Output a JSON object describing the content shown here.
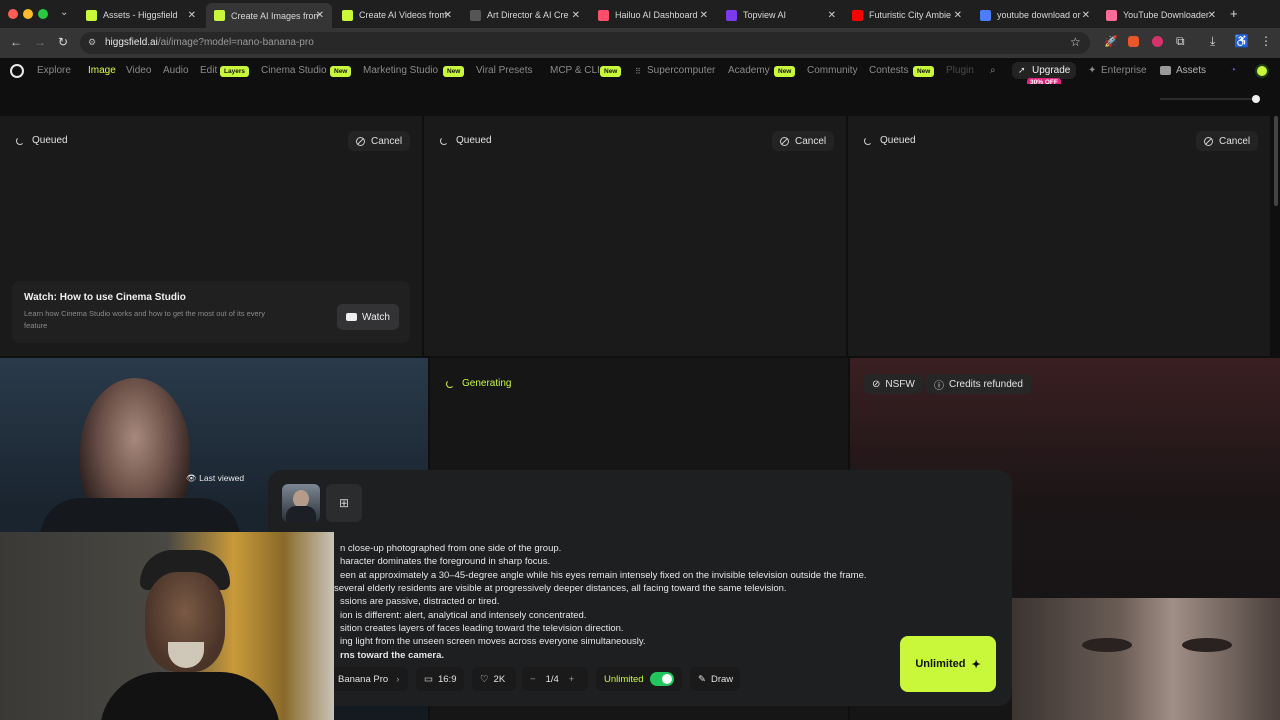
{
  "browser": {
    "tabs": [
      {
        "title": "Assets - Higgsfield",
        "fav_color": "#c9f73a"
      },
      {
        "title": "Create AI Images from",
        "fav_color": "#c9f73a"
      },
      {
        "title": "Create AI Videos from",
        "fav_color": "#c9f73a"
      },
      {
        "title": "Art Director & AI Cre",
        "fav_color": "#555555"
      },
      {
        "title": "Hailuo AI Dashboard",
        "fav_color": "#ff4d6a"
      },
      {
        "title": "Topview AI",
        "fav_color": "#7c3aed"
      },
      {
        "title": "Futuristic City Ambie",
        "fav_color": "#ff0000"
      },
      {
        "title": "youtube download or",
        "fav_color": "#4a7dff"
      },
      {
        "title": "YouTube Downloader",
        "fav_color": "#ff6b9a"
      }
    ],
    "url_host": "higgsfield.ai",
    "url_path": "/ai/image?model=nano-banana-pro"
  },
  "nav": {
    "items": [
      "Explore",
      "Image",
      "Video",
      "Audio",
      "Edit",
      "Cinema Studio",
      "Marketing Studio",
      "Viral Presets",
      "MCP & CLI",
      "Supercomputer",
      "Academy",
      "Community",
      "Contests",
      "Plugin"
    ],
    "layers_badge": "Layers",
    "new_badge": "New",
    "upgrade": "Upgrade",
    "upgrade_badge": "30% OFF",
    "enterprise": "Enterprise",
    "assets": "Assets"
  },
  "panels": {
    "queued_label": "Queued",
    "cancel_label": "Cancel",
    "generating_label": "Generating",
    "nsfw_label": "NSFW",
    "credits_label": "Credits refunded",
    "last_viewed": "Last viewed"
  },
  "watch_card": {
    "title": "Watch: How to use Cinema Studio",
    "desc_line1": "Learn how Cinema Studio works and how to get the most out of its every",
    "desc_line2": "feature",
    "button": "Watch"
  },
  "prompt": {
    "lines": [
      "n close-up photographed from one side of the group.",
      "haracter dominates the foreground in sharp focus.",
      "een at approximately a 30–45-degree angle while his eyes remain intensely fixed on the invisible television outside the frame.",
      " several elderly residents are visible at progressively deeper distances, all facing toward the same television.",
      "ssions are passive, distracted or tired.",
      "ion is different: alert, analytical and intensely concentrated.",
      "sition creates layers of faces leading toward the television direction.",
      "ing light from the unseen screen moves across everyone simultaneously.",
      "rns toward the camera."
    ]
  },
  "toolbar": {
    "model": "Banana Pro",
    "ratio": "16:9",
    "quality": "2K",
    "count": "1/4",
    "unlimited": "Unlimited",
    "unlimited_on": true,
    "draw": "Draw",
    "generate": "Unlimited"
  },
  "colors": {
    "accent": "#c9f73a",
    "upgrade_badge": "#e0237c",
    "toggle_on": "#22c55e"
  }
}
